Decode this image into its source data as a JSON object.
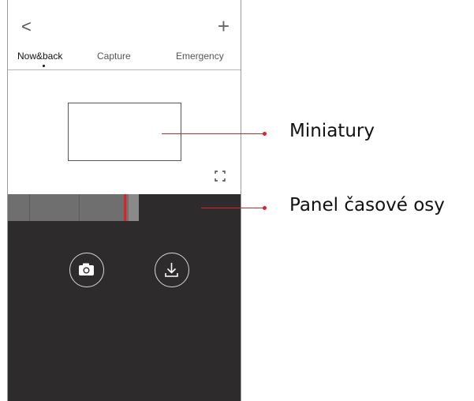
{
  "header": {
    "back_label": "<",
    "add_label": "+"
  },
  "tabs": [
    {
      "label": "Now&back",
      "active": true
    },
    {
      "label": "Capture",
      "active": false
    },
    {
      "label": "Emergency",
      "active": false
    }
  ],
  "icons": {
    "fullscreen": "fullscreen-icon",
    "capture": "camera-icon",
    "download": "download-icon"
  },
  "callouts": [
    {
      "label": "Miniatury"
    },
    {
      "label": "Panel časové osy"
    }
  ],
  "colors": {
    "accent": "#e0202a",
    "dark_panel": "#2d2b2b",
    "timeline_recorded": "#6f6f6f"
  }
}
